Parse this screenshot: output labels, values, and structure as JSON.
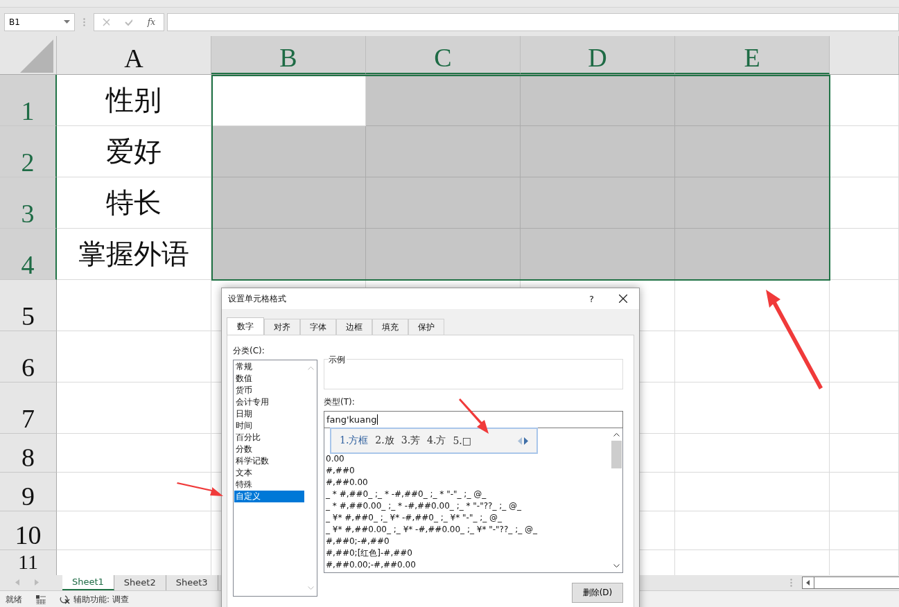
{
  "formula_bar": {
    "name_box": "B1",
    "function_label": "fx"
  },
  "columns": [
    {
      "label": "A",
      "selected": false
    },
    {
      "label": "B",
      "selected": true
    },
    {
      "label": "C",
      "selected": true
    },
    {
      "label": "D",
      "selected": true
    },
    {
      "label": "E",
      "selected": true
    }
  ],
  "rows": [
    {
      "label": "1",
      "selected": true,
      "cells": [
        {
          "text": "性别",
          "selected": false
        },
        {
          "selected": false
        },
        {
          "selected": true
        },
        {
          "selected": true
        },
        {
          "selected": true
        }
      ]
    },
    {
      "label": "2",
      "selected": true,
      "cells": [
        {
          "text": "爱好",
          "selected": false
        },
        {
          "selected": true
        },
        {
          "selected": true
        },
        {
          "selected": true
        },
        {
          "selected": true
        }
      ]
    },
    {
      "label": "3",
      "selected": true,
      "cells": [
        {
          "text": "特长",
          "selected": false
        },
        {
          "selected": true
        },
        {
          "selected": true
        },
        {
          "selected": true
        },
        {
          "selected": true
        }
      ]
    },
    {
      "label": "4",
      "selected": true,
      "cells": [
        {
          "text": "掌握外语",
          "selected": false
        },
        {
          "selected": true
        },
        {
          "selected": true
        },
        {
          "selected": true
        },
        {
          "selected": true
        }
      ]
    },
    {
      "label": "5",
      "selected": false
    },
    {
      "label": "6",
      "selected": false
    },
    {
      "label": "7",
      "selected": false
    },
    {
      "label": "8",
      "selected": false
    },
    {
      "label": "9",
      "selected": false
    },
    {
      "label": "10",
      "selected": false
    },
    {
      "label": "11",
      "selected": false
    }
  ],
  "sheet_tabs": [
    {
      "label": "Sheet1",
      "selected": true
    },
    {
      "label": "Sheet2",
      "selected": false
    },
    {
      "label": "Sheet3",
      "selected": false
    }
  ],
  "status_bar": {
    "ready": "就绪",
    "accessibility": "辅助功能: 调查"
  },
  "dialog": {
    "title": "设置单元格格式",
    "help": "?",
    "tabs": [
      {
        "label": "数字",
        "selected": true
      },
      {
        "label": "对齐",
        "selected": false
      },
      {
        "label": "字体",
        "selected": false
      },
      {
        "label": "边框",
        "selected": false
      },
      {
        "label": "填充",
        "selected": false
      },
      {
        "label": "保护",
        "selected": false
      }
    ],
    "category_label": "分类(C):",
    "categories": [
      {
        "label": "常规",
        "selected": false
      },
      {
        "label": "数值",
        "selected": false
      },
      {
        "label": "货币",
        "selected": false
      },
      {
        "label": "会计专用",
        "selected": false
      },
      {
        "label": "日期",
        "selected": false
      },
      {
        "label": "时间",
        "selected": false
      },
      {
        "label": "百分比",
        "selected": false
      },
      {
        "label": "分数",
        "selected": false
      },
      {
        "label": "科学记数",
        "selected": false
      },
      {
        "label": "文本",
        "selected": false
      },
      {
        "label": "特殊",
        "selected": false
      },
      {
        "label": "自定义",
        "selected": true
      }
    ],
    "sample_label": "示例",
    "type_label": "类型(T):",
    "type_value": "fang'kuang",
    "formats": [
      "0.00",
      "#,##0",
      "#,##0.00",
      "_ * #,##0_ ;_ * -#,##0_ ;_ * \"-\"_ ;_ @_",
      "_ * #,##0.00_ ;_ * -#,##0.00_ ;_ * \"-\"??_ ;_ @_",
      "_ ¥* #,##0_ ;_ ¥* -#,##0_ ;_ ¥* \"-\"_ ;_ @_",
      "_ ¥* #,##0.00_ ;_ ¥* -#,##0.00_ ;_ ¥* \"-\"??_ ;_ @_",
      "#,##0;-#,##0",
      "#,##0;[红色]-#,##0",
      "#,##0.00;-#,##0.00"
    ],
    "delete_button": "删除(D)"
  },
  "ime": {
    "candidates": [
      {
        "label": "1.方框",
        "selected": true
      },
      {
        "label": "2.放",
        "selected": false
      },
      {
        "label": "3.芳",
        "selected": false
      },
      {
        "label": "4.方",
        "selected": false
      },
      {
        "label": "5.□",
        "selected": false
      }
    ]
  }
}
